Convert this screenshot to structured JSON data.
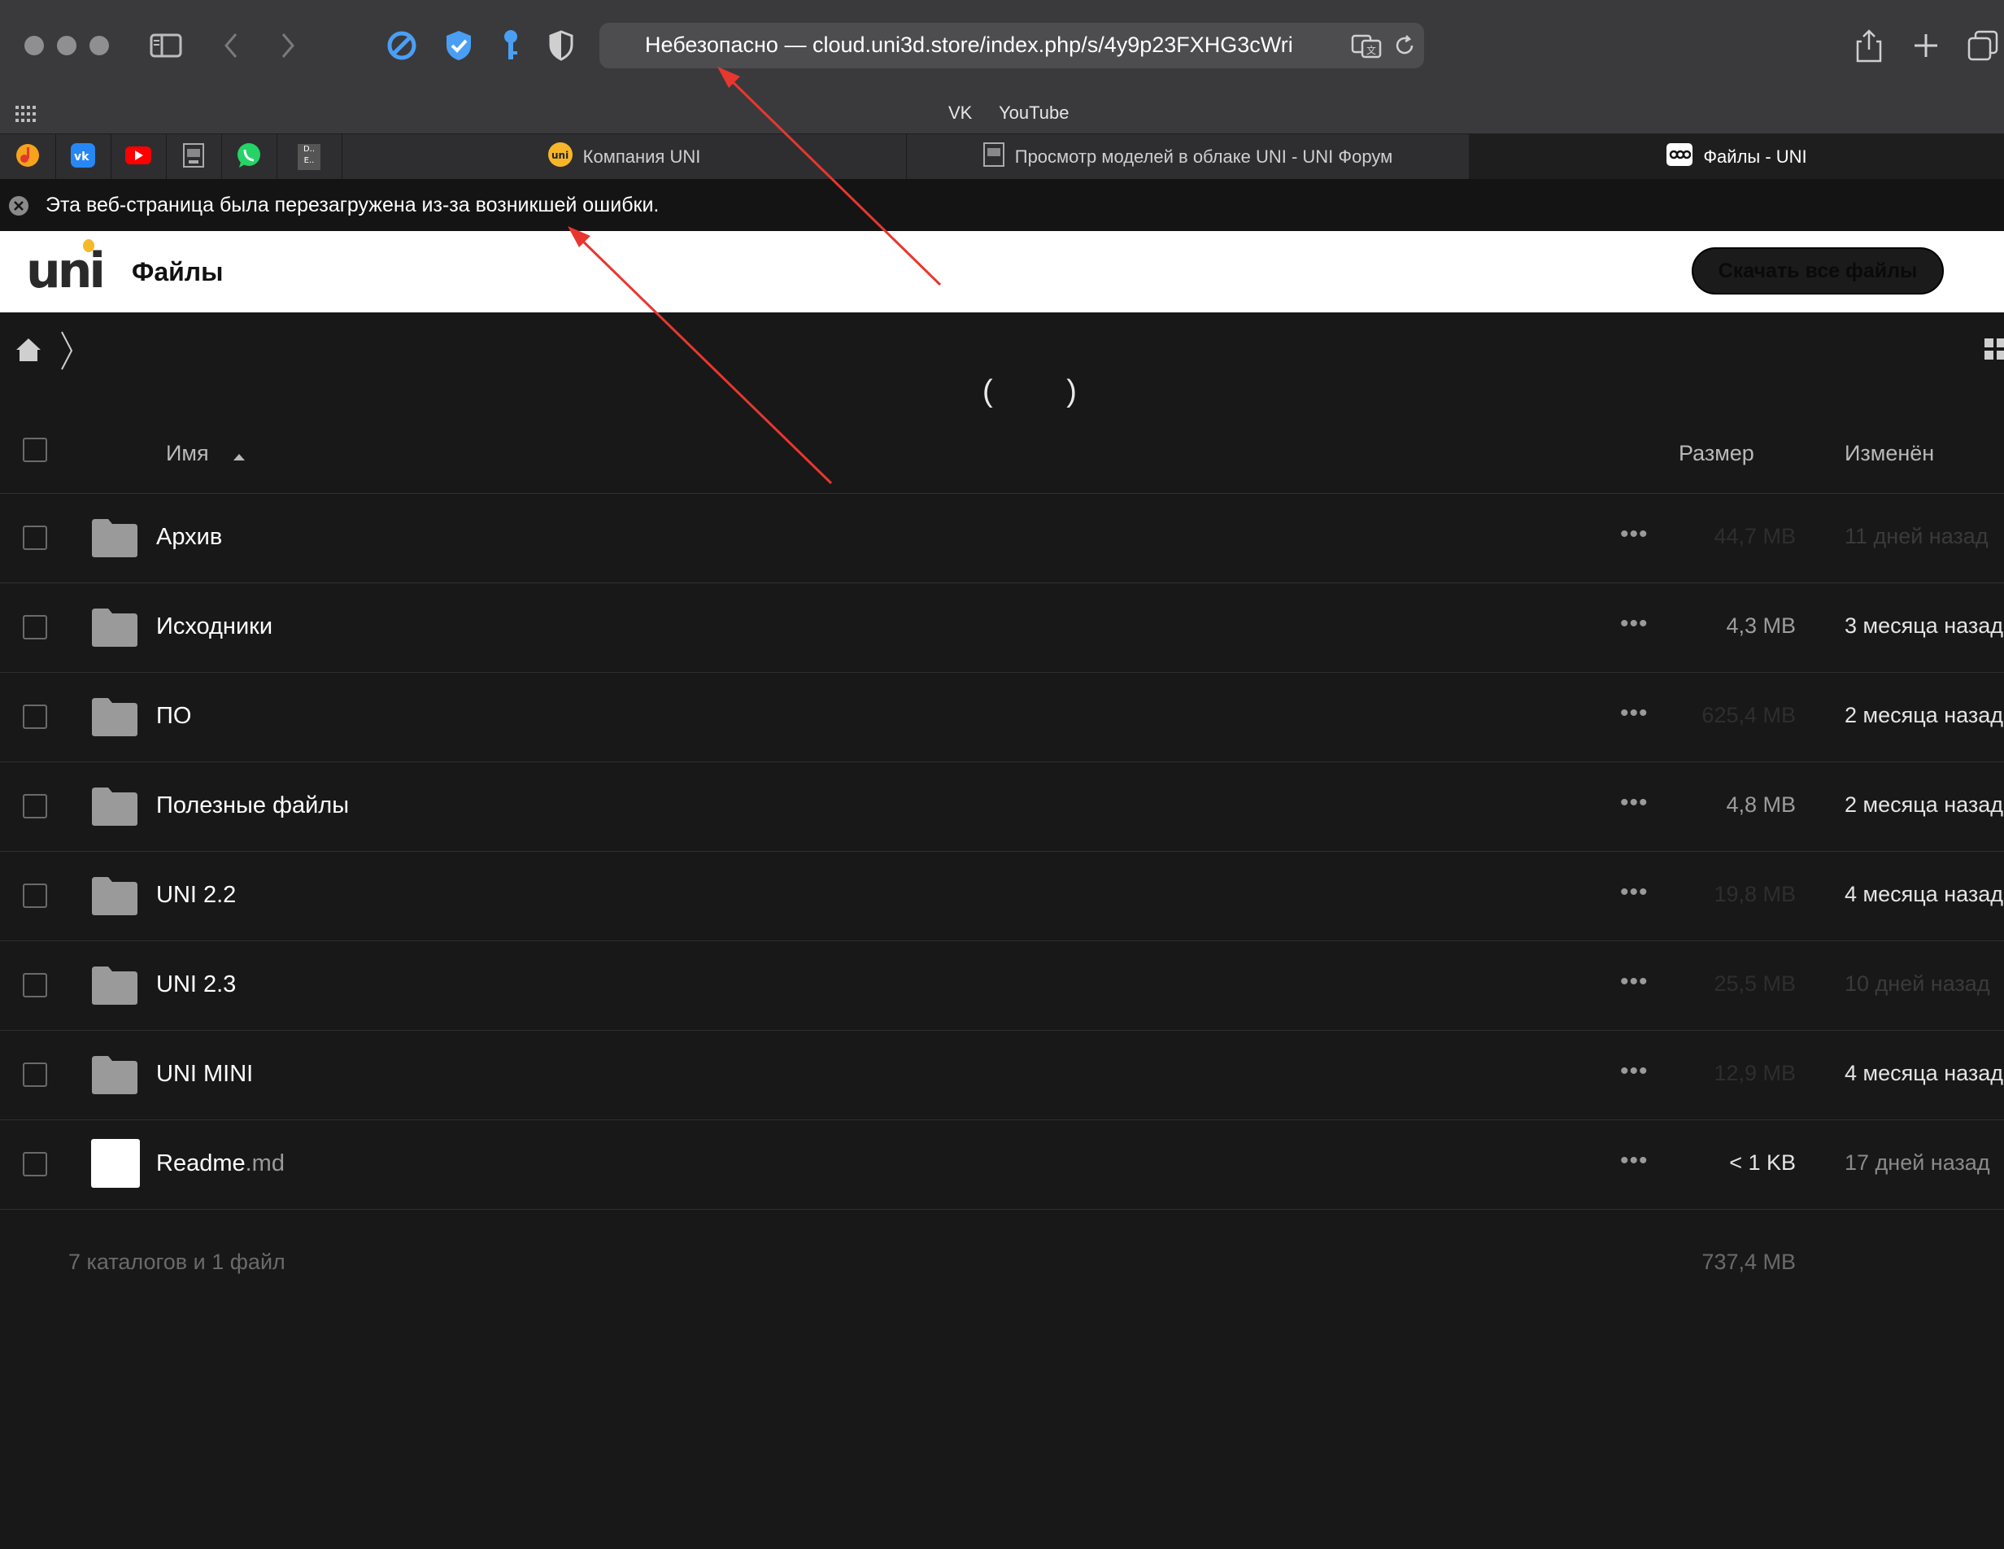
{
  "browser": {
    "url": "Небезопасно — cloud.uni3d.store/index.php/s/4y9p23FXHG3cWri",
    "favorites": [
      "VK",
      "YouTube"
    ],
    "tabs": [
      {
        "title": "Компания UNI",
        "icon": "uni-favicon"
      },
      {
        "title": "Просмотр моделей в облаке UNI - UNI Форум",
        "icon": "forum-favicon"
      },
      {
        "title": "Файлы - UNI",
        "icon": "nextcloud-favicon",
        "active": true
      }
    ],
    "pinned_tabs": [
      "music-icon",
      "vk-icon",
      "youtube-icon",
      "printer-icon",
      "whatsapp-icon",
      "doc-icon"
    ],
    "pinned_doc_label": "D.. E..",
    "error_message": "Эта веб-страница была перезагружена из-за возникшей ошибки."
  },
  "header": {
    "logo": "uni",
    "title": "Файлы",
    "download_all": "Скачать все файлы"
  },
  "list": {
    "spinner": "( )",
    "columns": {
      "name": "Имя",
      "size": "Размер",
      "modified": "Изменён"
    },
    "rows": [
      {
        "name": "Архив",
        "ext": "",
        "type": "folder",
        "size": "44,7 MB",
        "modified": "11 дней назад",
        "size_color": "#2e2e2e",
        "mod_color": "#3a3a3a"
      },
      {
        "name": "Исходники",
        "ext": "",
        "type": "folder",
        "size": "4,3 MB",
        "modified": "3 месяца назад",
        "size_color": "#9c9c9c",
        "mod_color": "#e4e4e4"
      },
      {
        "name": "ПО",
        "ext": "",
        "type": "folder",
        "size": "625,4 MB",
        "modified": "2 месяца назад",
        "size_color": "#2e2e2e",
        "mod_color": "#e4e4e4"
      },
      {
        "name": "Полезные файлы",
        "ext": "",
        "type": "folder",
        "size": "4,8 MB",
        "modified": "2 месяца назад",
        "size_color": "#9c9c9c",
        "mod_color": "#e4e4e4"
      },
      {
        "name": "UNI 2.2",
        "ext": "",
        "type": "folder",
        "size": "19,8 MB",
        "modified": "4 месяца назад",
        "size_color": "#2e2e2e",
        "mod_color": "#e4e4e4"
      },
      {
        "name": "UNI 2.3",
        "ext": "",
        "type": "folder",
        "size": "25,5 MB",
        "modified": "10 дней назад",
        "size_color": "#2e2e2e",
        "mod_color": "#3a3a3a"
      },
      {
        "name": "UNI MINI",
        "ext": "",
        "type": "folder",
        "size": "12,9 MB",
        "modified": "4 месяца назад",
        "size_color": "#2e2e2e",
        "mod_color": "#e4e4e4"
      },
      {
        "name": "Readme",
        "ext": ".md",
        "type": "file",
        "size": "< 1 KB",
        "modified": "17 дней назад",
        "size_color": "#e4e4e4",
        "mod_color": "#8a8a8a"
      }
    ],
    "summary_count": "7 каталогов и 1 файл",
    "summary_size": "737,4 MB"
  },
  "colors": {
    "annotation_arrow": "#e8372f",
    "accent_blue": "#4a9ff5"
  }
}
